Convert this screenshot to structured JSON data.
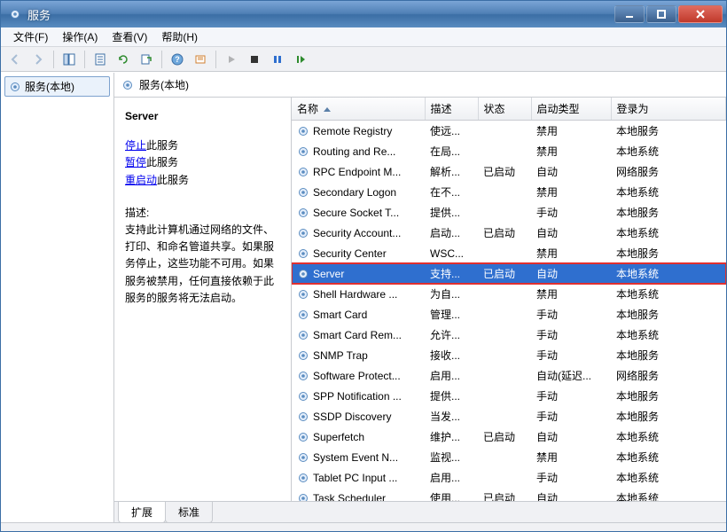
{
  "window": {
    "title": "服务"
  },
  "menubar": [
    {
      "label": "文件(F)"
    },
    {
      "label": "操作(A)"
    },
    {
      "label": "查看(V)"
    },
    {
      "label": "帮助(H)"
    }
  ],
  "nav": {
    "root_label": "服务(本地)"
  },
  "main_header": {
    "title": "服务(本地)"
  },
  "detail": {
    "selected_name": "Server",
    "link_stop": "停止",
    "link_pause": "暂停",
    "link_restart": "重启动",
    "link_suffix": "此服务",
    "desc_label": "描述:",
    "desc_text": "支持此计算机通过网络的文件、打印、和命名管道共享。如果服务停止，这些功能不可用。如果服务被禁用，任何直接依赖于此服务的服务将无法启动。"
  },
  "columns": {
    "name": "名称",
    "desc": "描述",
    "status": "状态",
    "startup": "启动类型",
    "logon": "登录为"
  },
  "services": [
    {
      "name": "Remote Registry",
      "desc": "使远...",
      "status": "",
      "startup": "禁用",
      "logon": "本地服务"
    },
    {
      "name": "Routing and Re...",
      "desc": "在局...",
      "status": "",
      "startup": "禁用",
      "logon": "本地系统"
    },
    {
      "name": "RPC Endpoint M...",
      "desc": "解析...",
      "status": "已启动",
      "startup": "自动",
      "logon": "网络服务"
    },
    {
      "name": "Secondary Logon",
      "desc": "在不...",
      "status": "",
      "startup": "禁用",
      "logon": "本地系统"
    },
    {
      "name": "Secure Socket T...",
      "desc": "提供...",
      "status": "",
      "startup": "手动",
      "logon": "本地服务"
    },
    {
      "name": "Security Account...",
      "desc": "启动...",
      "status": "已启动",
      "startup": "自动",
      "logon": "本地系统"
    },
    {
      "name": "Security Center",
      "desc": "WSC...",
      "status": "",
      "startup": "禁用",
      "logon": "本地服务"
    },
    {
      "name": "Server",
      "desc": "支持...",
      "status": "已启动",
      "startup": "自动",
      "logon": "本地系统",
      "selected": true
    },
    {
      "name": "Shell Hardware ...",
      "desc": "为自...",
      "status": "",
      "startup": "禁用",
      "logon": "本地系统"
    },
    {
      "name": "Smart Card",
      "desc": "管理...",
      "status": "",
      "startup": "手动",
      "logon": "本地服务"
    },
    {
      "name": "Smart Card Rem...",
      "desc": "允许...",
      "status": "",
      "startup": "手动",
      "logon": "本地系统"
    },
    {
      "name": "SNMP Trap",
      "desc": "接收...",
      "status": "",
      "startup": "手动",
      "logon": "本地服务"
    },
    {
      "name": "Software Protect...",
      "desc": "启用...",
      "status": "",
      "startup": "自动(延迟...",
      "logon": "网络服务"
    },
    {
      "name": "SPP Notification ...",
      "desc": "提供...",
      "status": "",
      "startup": "手动",
      "logon": "本地服务"
    },
    {
      "name": "SSDP Discovery",
      "desc": "当发...",
      "status": "",
      "startup": "手动",
      "logon": "本地服务"
    },
    {
      "name": "Superfetch",
      "desc": "维护...",
      "status": "已启动",
      "startup": "自动",
      "logon": "本地系统"
    },
    {
      "name": "System Event N...",
      "desc": "监视...",
      "status": "",
      "startup": "禁用",
      "logon": "本地系统"
    },
    {
      "name": "Tablet PC Input ...",
      "desc": "启用...",
      "status": "",
      "startup": "手动",
      "logon": "本地系统"
    },
    {
      "name": "Task Scheduler",
      "desc": "使用...",
      "status": "已启动",
      "startup": "自动",
      "logon": "本地系统"
    }
  ],
  "tabs": {
    "extended": "扩展",
    "standard": "标准"
  }
}
